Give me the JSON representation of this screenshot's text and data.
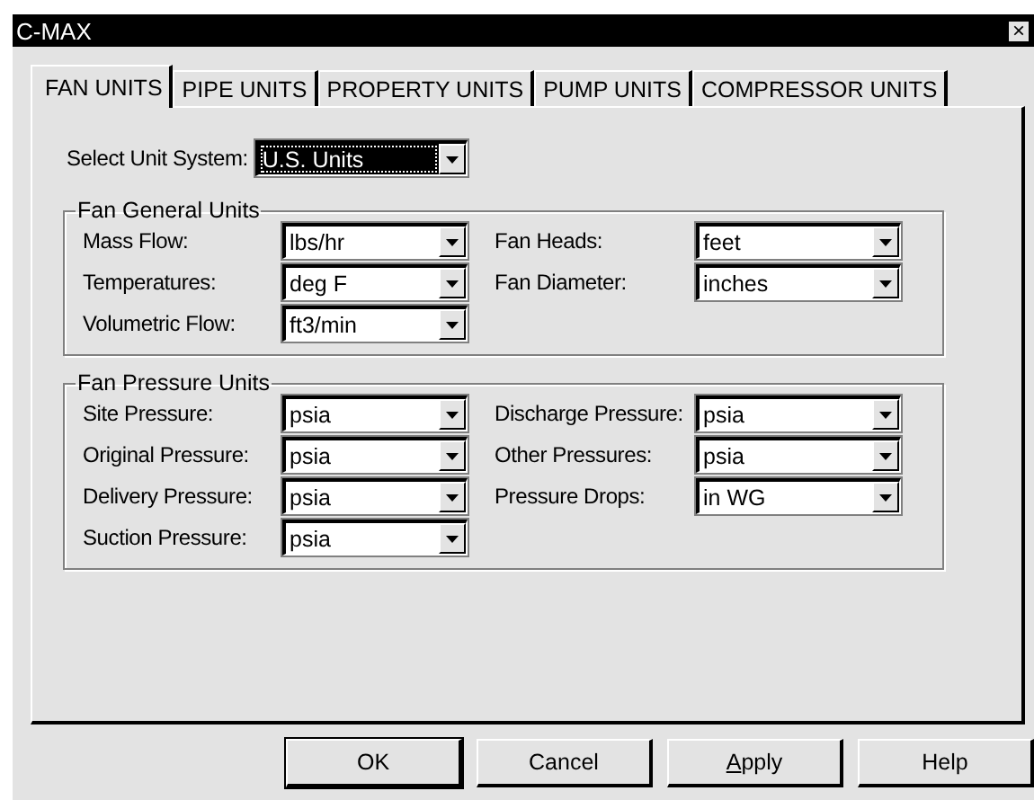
{
  "window": {
    "title": "C-MAX",
    "close": "×"
  },
  "tabs": [
    {
      "label": "FAN UNITS",
      "selected": true
    },
    {
      "label": "PIPE UNITS",
      "selected": false
    },
    {
      "label": "PROPERTY UNITS",
      "selected": false
    },
    {
      "label": "PUMP UNITS",
      "selected": false
    },
    {
      "label": "COMPRESSOR UNITS",
      "selected": false
    }
  ],
  "unit_system": {
    "label": "Select Unit System:",
    "value": "U.S. Units",
    "focused": true
  },
  "groups": [
    {
      "title": "Fan General Units",
      "fields": [
        {
          "label": "Mass Flow:",
          "value": "lbs/hr"
        },
        {
          "label": "Fan Heads:",
          "value": "feet"
        },
        {
          "label": "Temperatures:",
          "value": "deg F"
        },
        {
          "label": "Fan Diameter:",
          "value": "inches"
        },
        {
          "label": "Volumetric Flow:",
          "value": "ft3/min"
        }
      ]
    },
    {
      "title": "Fan Pressure Units",
      "fields": [
        {
          "label": "Site Pressure:",
          "value": "psia"
        },
        {
          "label": "Discharge Pressure:",
          "value": "psia"
        },
        {
          "label": "Original Pressure:",
          "value": "psia"
        },
        {
          "label": "Other Pressures:",
          "value": "psia"
        },
        {
          "label": "Delivery Pressure:",
          "value": "psia"
        },
        {
          "label": "Pressure Drops:",
          "value": "in WG"
        },
        {
          "label": "Suction Pressure:",
          "value": "psia"
        }
      ]
    }
  ],
  "buttons": [
    {
      "label": "OK",
      "default": true
    },
    {
      "label": "Cancel",
      "default": false
    },
    {
      "label": "Apply",
      "default": false,
      "first_letter_underlined": true
    },
    {
      "label": "Help",
      "default": false
    }
  ]
}
